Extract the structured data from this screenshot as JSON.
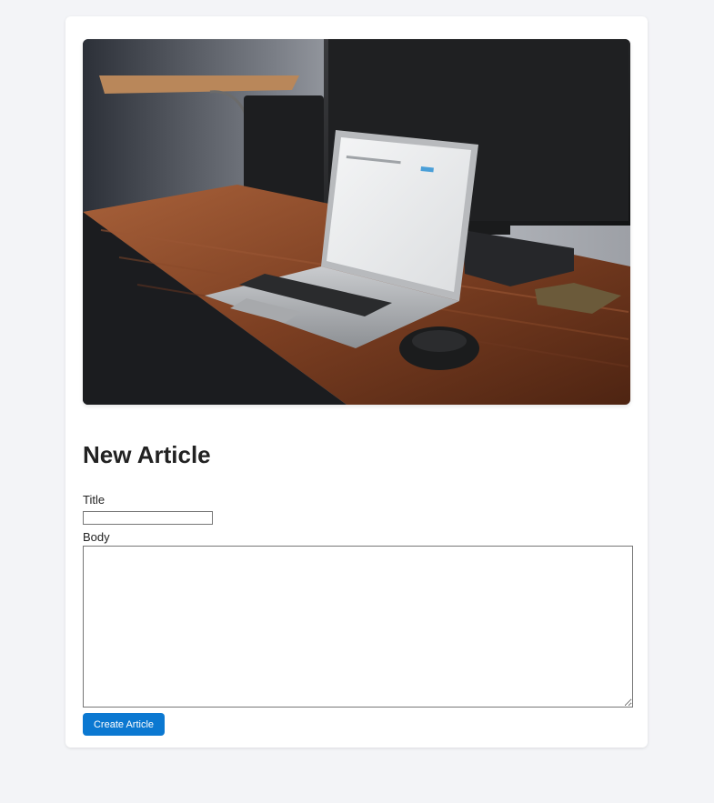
{
  "hero_image": {
    "description_icon": "laptop-on-desk-photo"
  },
  "form": {
    "heading": "New Article",
    "title_label": "Title",
    "title_value": "",
    "body_label": "Body",
    "body_value": "",
    "submit_label": "Create Article"
  },
  "colors": {
    "page_background": "#f3f4f7",
    "card_background": "#ffffff",
    "button_background": "#0b78d1",
    "button_text": "#ffffff"
  }
}
